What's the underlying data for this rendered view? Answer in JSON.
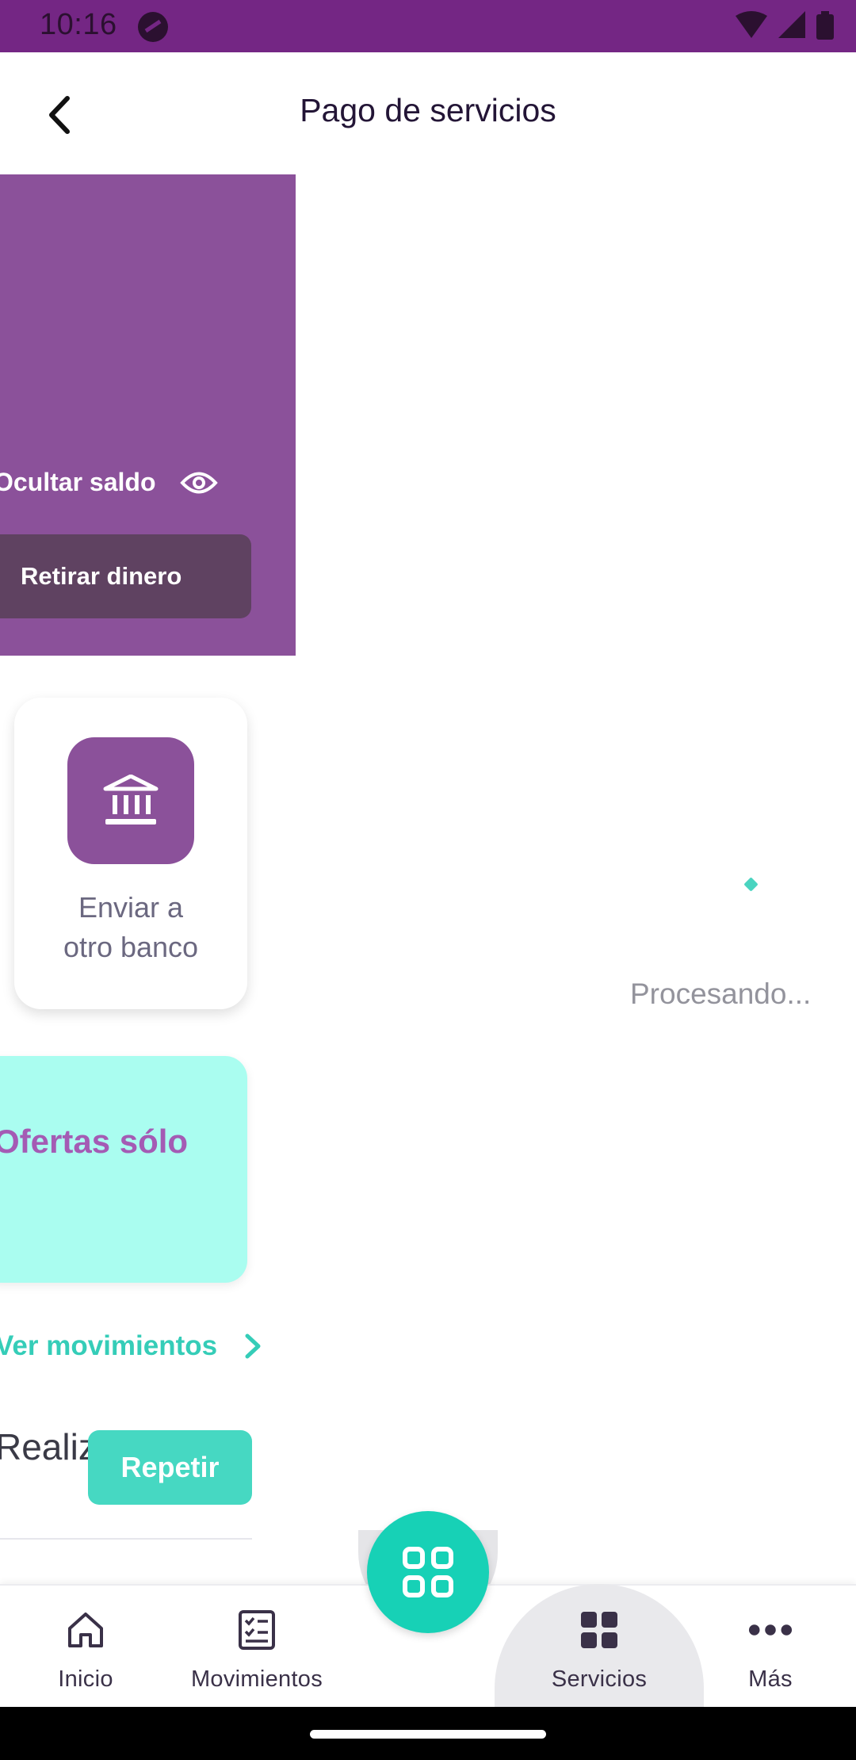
{
  "status_bar": {
    "time": "10:16",
    "background": "#742684"
  },
  "app_bar": {
    "title": "Pago de servicios",
    "back_icon": "chevron-left-icon"
  },
  "home_fragment": {
    "hide_balance_label": "Ocultar saldo",
    "withdraw_label": "Retirar dinero",
    "transfer_label_line1": "Enviar a",
    "transfer_label_line2": "otro banco",
    "promo_text": "Ofertas sólo",
    "movements_link": "Ver movimientos",
    "history_item_name": "Realizar",
    "repeat_label": "Repetir"
  },
  "processing": {
    "text": "Procesando..."
  },
  "bottom_nav": {
    "items": [
      {
        "label": "Inicio",
        "icon": "home-icon"
      },
      {
        "label": "Movimientos",
        "icon": "checklist-icon"
      },
      {
        "label": "Servicios",
        "icon": "grid-icon",
        "selected": true
      },
      {
        "label": "Más",
        "icon": "more-dots-icon"
      }
    ],
    "fab_icon": "apps-grid-icon"
  },
  "colors": {
    "brand_purple": "#8b519a",
    "accent_teal": "#17d1b6",
    "promo_bg": "#aafdf0"
  }
}
